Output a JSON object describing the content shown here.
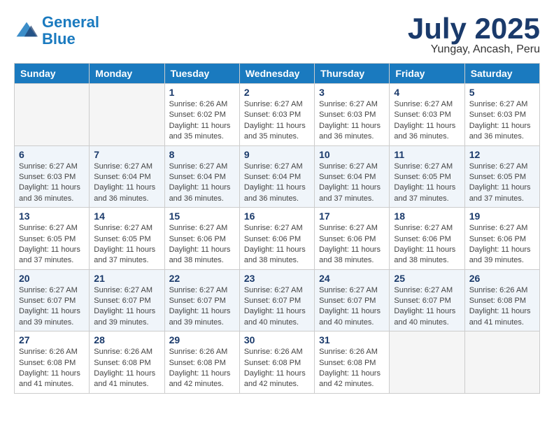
{
  "logo": {
    "line1": "General",
    "line2": "Blue"
  },
  "title": "July 2025",
  "subtitle": "Yungay, Ancash, Peru",
  "days_of_week": [
    "Sunday",
    "Monday",
    "Tuesday",
    "Wednesday",
    "Thursday",
    "Friday",
    "Saturday"
  ],
  "weeks": [
    [
      {
        "day": "",
        "info": ""
      },
      {
        "day": "",
        "info": ""
      },
      {
        "day": "1",
        "info": "Sunrise: 6:26 AM\nSunset: 6:02 PM\nDaylight: 11 hours and 35 minutes."
      },
      {
        "day": "2",
        "info": "Sunrise: 6:27 AM\nSunset: 6:03 PM\nDaylight: 11 hours and 35 minutes."
      },
      {
        "day": "3",
        "info": "Sunrise: 6:27 AM\nSunset: 6:03 PM\nDaylight: 11 hours and 36 minutes."
      },
      {
        "day": "4",
        "info": "Sunrise: 6:27 AM\nSunset: 6:03 PM\nDaylight: 11 hours and 36 minutes."
      },
      {
        "day": "5",
        "info": "Sunrise: 6:27 AM\nSunset: 6:03 PM\nDaylight: 11 hours and 36 minutes."
      }
    ],
    [
      {
        "day": "6",
        "info": "Sunrise: 6:27 AM\nSunset: 6:03 PM\nDaylight: 11 hours and 36 minutes."
      },
      {
        "day": "7",
        "info": "Sunrise: 6:27 AM\nSunset: 6:04 PM\nDaylight: 11 hours and 36 minutes."
      },
      {
        "day": "8",
        "info": "Sunrise: 6:27 AM\nSunset: 6:04 PM\nDaylight: 11 hours and 36 minutes."
      },
      {
        "day": "9",
        "info": "Sunrise: 6:27 AM\nSunset: 6:04 PM\nDaylight: 11 hours and 36 minutes."
      },
      {
        "day": "10",
        "info": "Sunrise: 6:27 AM\nSunset: 6:04 PM\nDaylight: 11 hours and 37 minutes."
      },
      {
        "day": "11",
        "info": "Sunrise: 6:27 AM\nSunset: 6:05 PM\nDaylight: 11 hours and 37 minutes."
      },
      {
        "day": "12",
        "info": "Sunrise: 6:27 AM\nSunset: 6:05 PM\nDaylight: 11 hours and 37 minutes."
      }
    ],
    [
      {
        "day": "13",
        "info": "Sunrise: 6:27 AM\nSunset: 6:05 PM\nDaylight: 11 hours and 37 minutes."
      },
      {
        "day": "14",
        "info": "Sunrise: 6:27 AM\nSunset: 6:05 PM\nDaylight: 11 hours and 37 minutes."
      },
      {
        "day": "15",
        "info": "Sunrise: 6:27 AM\nSunset: 6:06 PM\nDaylight: 11 hours and 38 minutes."
      },
      {
        "day": "16",
        "info": "Sunrise: 6:27 AM\nSunset: 6:06 PM\nDaylight: 11 hours and 38 minutes."
      },
      {
        "day": "17",
        "info": "Sunrise: 6:27 AM\nSunset: 6:06 PM\nDaylight: 11 hours and 38 minutes."
      },
      {
        "day": "18",
        "info": "Sunrise: 6:27 AM\nSunset: 6:06 PM\nDaylight: 11 hours and 38 minutes."
      },
      {
        "day": "19",
        "info": "Sunrise: 6:27 AM\nSunset: 6:06 PM\nDaylight: 11 hours and 39 minutes."
      }
    ],
    [
      {
        "day": "20",
        "info": "Sunrise: 6:27 AM\nSunset: 6:07 PM\nDaylight: 11 hours and 39 minutes."
      },
      {
        "day": "21",
        "info": "Sunrise: 6:27 AM\nSunset: 6:07 PM\nDaylight: 11 hours and 39 minutes."
      },
      {
        "day": "22",
        "info": "Sunrise: 6:27 AM\nSunset: 6:07 PM\nDaylight: 11 hours and 39 minutes."
      },
      {
        "day": "23",
        "info": "Sunrise: 6:27 AM\nSunset: 6:07 PM\nDaylight: 11 hours and 40 minutes."
      },
      {
        "day": "24",
        "info": "Sunrise: 6:27 AM\nSunset: 6:07 PM\nDaylight: 11 hours and 40 minutes."
      },
      {
        "day": "25",
        "info": "Sunrise: 6:27 AM\nSunset: 6:07 PM\nDaylight: 11 hours and 40 minutes."
      },
      {
        "day": "26",
        "info": "Sunrise: 6:26 AM\nSunset: 6:08 PM\nDaylight: 11 hours and 41 minutes."
      }
    ],
    [
      {
        "day": "27",
        "info": "Sunrise: 6:26 AM\nSunset: 6:08 PM\nDaylight: 11 hours and 41 minutes."
      },
      {
        "day": "28",
        "info": "Sunrise: 6:26 AM\nSunset: 6:08 PM\nDaylight: 11 hours and 41 minutes."
      },
      {
        "day": "29",
        "info": "Sunrise: 6:26 AM\nSunset: 6:08 PM\nDaylight: 11 hours and 42 minutes."
      },
      {
        "day": "30",
        "info": "Sunrise: 6:26 AM\nSunset: 6:08 PM\nDaylight: 11 hours and 42 minutes."
      },
      {
        "day": "31",
        "info": "Sunrise: 6:26 AM\nSunset: 6:08 PM\nDaylight: 11 hours and 42 minutes."
      },
      {
        "day": "",
        "info": ""
      },
      {
        "day": "",
        "info": ""
      }
    ]
  ]
}
